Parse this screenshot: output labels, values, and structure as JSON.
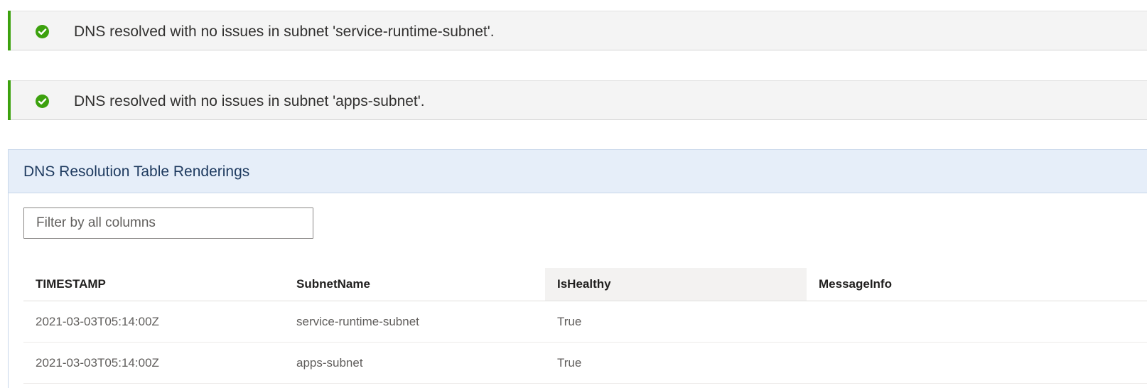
{
  "notices": [
    {
      "icon": "check-circle-icon",
      "status_color": "#3ca10e",
      "message": "DNS resolved with no issues in subnet 'service-runtime-subnet'."
    },
    {
      "icon": "check-circle-icon",
      "status_color": "#3ca10e",
      "message": "DNS resolved with no issues in subnet 'apps-subnet'."
    }
  ],
  "panel": {
    "title": "DNS Resolution Table Renderings",
    "header_bg": "#e6eef9",
    "filter": {
      "placeholder": "Filter by all columns",
      "value": ""
    },
    "table": {
      "columns": [
        "TIMESTAMP",
        "SubnetName",
        "IsHealthy",
        "MessageInfo"
      ],
      "rows": [
        [
          "2021-03-03T05:14:00Z",
          "service-runtime-subnet",
          "True",
          ""
        ],
        [
          "2021-03-03T05:14:00Z",
          "apps-subnet",
          "True",
          ""
        ]
      ]
    }
  }
}
